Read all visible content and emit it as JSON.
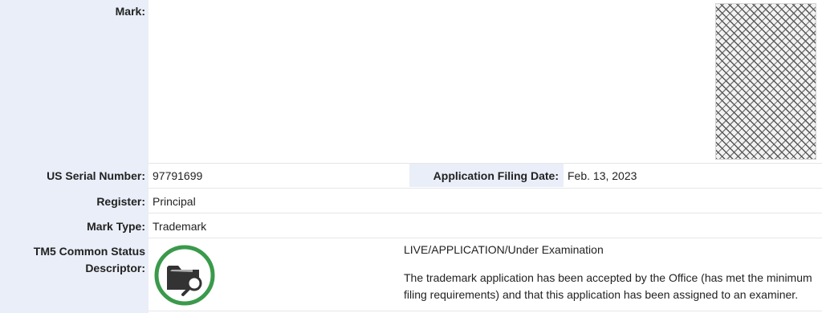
{
  "mark": {
    "label": "Mark:"
  },
  "serial": {
    "label": "US Serial Number:",
    "value": "97791699"
  },
  "filing": {
    "label": "Application Filing Date:",
    "value": "Feb. 13, 2023"
  },
  "register": {
    "label": "Register:",
    "value": "Principal"
  },
  "mark_type": {
    "label": "Mark Type:",
    "value": "Trademark"
  },
  "tm5": {
    "label_line1": "TM5 Common Status",
    "label_line2": "Descriptor:",
    "status": "LIVE/APPLICATION/Under Examination",
    "description_line1": "The trademark application has been accepted by the Office (has met the minimum",
    "description_line2": "filing requirements) and that this application has been assigned to an examiner.",
    "icon": "folder-search-icon",
    "ring_color": "#3a9a4b"
  },
  "colors": {
    "label_band": "#e9eef8"
  }
}
